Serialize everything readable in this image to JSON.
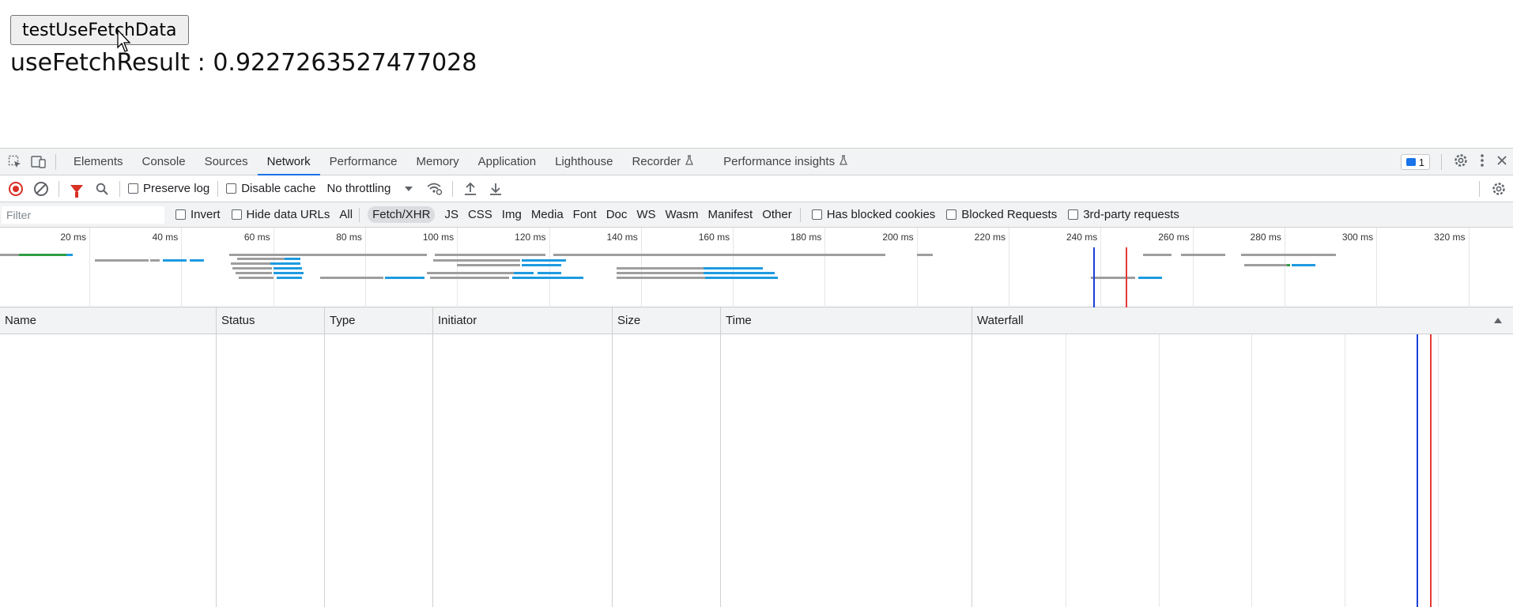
{
  "test_page": {
    "button_label": "testUseFetchData",
    "result_label": "useFetchResult : ",
    "result_value": "0.9227263527477028"
  },
  "devtools": {
    "tabs": [
      {
        "label": "Elements",
        "active": false
      },
      {
        "label": "Console",
        "active": false
      },
      {
        "label": "Sources",
        "active": false
      },
      {
        "label": "Network",
        "active": true
      },
      {
        "label": "Performance",
        "active": false
      },
      {
        "label": "Memory",
        "active": false
      },
      {
        "label": "Application",
        "active": false
      },
      {
        "label": "Lighthouse",
        "active": false
      },
      {
        "label": "Recorder",
        "active": false,
        "experimental": true
      },
      {
        "label": "Performance insights",
        "active": false,
        "experimental": true
      }
    ],
    "issues_count": "1",
    "toolbar": {
      "preserve_log": "Preserve log",
      "disable_cache": "Disable cache",
      "throttling": "No throttling"
    },
    "filter": {
      "placeholder": "Filter",
      "invert": "Invert",
      "hide_data_urls": "Hide data URLs",
      "types": [
        "All",
        "Fetch/XHR",
        "JS",
        "CSS",
        "Img",
        "Media",
        "Font",
        "Doc",
        "WS",
        "Wasm",
        "Manifest",
        "Other"
      ],
      "selected_type": "Fetch/XHR",
      "has_blocked_cookies": "Has blocked cookies",
      "blocked_requests": "Blocked Requests",
      "third_party": "3rd-party requests"
    },
    "overview_ticks": [
      "20 ms",
      "40 ms",
      "60 ms",
      "80 ms",
      "100 ms",
      "120 ms",
      "140 ms",
      "160 ms",
      "180 ms",
      "200 ms",
      "220 ms",
      "240 ms",
      "260 ms",
      "280 ms",
      "300 ms",
      "320 ms"
    ],
    "columns": [
      "Name",
      "Status",
      "Type",
      "Initiator",
      "Size",
      "Time",
      "Waterfall"
    ],
    "colors": {
      "accent": "#1a73e8",
      "record": "#d93025",
      "dom_content_loaded": "#1a3fd8",
      "load": "#e53935",
      "bar_waiting": "#9e9e9e",
      "bar_download": "#1e9be0",
      "bar_connect": "#2e9e44"
    }
  }
}
